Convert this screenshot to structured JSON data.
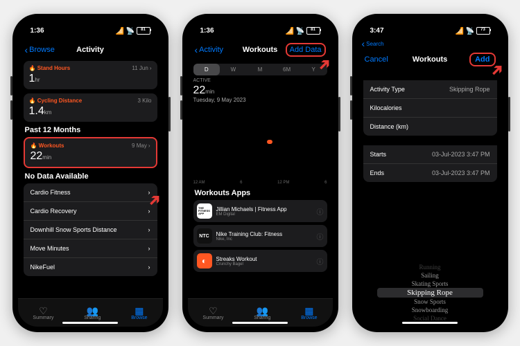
{
  "p1": {
    "time": "1:36",
    "batt": "81",
    "back": "Browse",
    "title": "Activity",
    "c1": {
      "label": "Stand Hours",
      "date": "11 Jun",
      "val": "1",
      "unit": "hr"
    },
    "c2": {
      "label": "Cycling Distance",
      "date": "3 Kilo",
      "val": "1.4",
      "unit": "km"
    },
    "sec1": "Past 12 Months",
    "c3": {
      "label": "Workouts",
      "date": "9 May",
      "val": "22",
      "unit": "min"
    },
    "sec2": "No Data Available",
    "rows": [
      "Cardio Fitness",
      "Cardio Recovery",
      "Downhill Snow Sports Distance",
      "Move Minutes",
      "NikeFuel"
    ],
    "tabs": [
      "Summary",
      "Sharing",
      "Browse"
    ]
  },
  "p2": {
    "time": "1:36",
    "batt": "81",
    "back": "Activity",
    "title": "Workouts",
    "action": "Add Data",
    "seg": [
      "D",
      "W",
      "M",
      "6M",
      "Y"
    ],
    "active_label": "ACTIVE",
    "val": "22",
    "unit": "min",
    "date": "Tuesday, 9 May 2023",
    "axis": [
      "12 AM",
      "6",
      "12 PM",
      "6"
    ],
    "apps_title": "Workouts Apps",
    "apps": [
      {
        "name": "Jillian Michaels | Fitness App",
        "sub": "EM Digital",
        "bg": "#fff",
        "fg": "#000",
        "txt": "THE\nFITNESS\nAPP"
      },
      {
        "name": "Nike Training Club: Fitness",
        "sub": "Nike, Inc",
        "bg": "#111",
        "fg": "#fff",
        "txt": "NTC"
      },
      {
        "name": "Streaks Workout",
        "sub": "Crunchy Bagel",
        "bg": "#ff5722",
        "fg": "#fff",
        "txt": "◐"
      }
    ],
    "tabs": [
      "Summary",
      "Sharing",
      "Browse"
    ]
  },
  "p3": {
    "time": "3:47",
    "batt": "73",
    "search": "Search",
    "cancel": "Cancel",
    "title": "Workouts",
    "action": "Add",
    "rows": [
      {
        "l": "Activity Type",
        "v": "Skipping Rope"
      },
      {
        "l": "Kilocalories",
        "v": ""
      },
      {
        "l": "Distance (km)",
        "v": ""
      }
    ],
    "rows2": [
      {
        "l": "Starts",
        "v": "03-Jul-2023  3:47 PM"
      },
      {
        "l": "Ends",
        "v": "03-Jul-2023  3:47 PM"
      }
    ],
    "picker": [
      "Running",
      "Sailing",
      "Skating Sports",
      "Skipping Rope",
      "Snow Sports",
      "Snowboarding",
      "Social Dance"
    ]
  }
}
